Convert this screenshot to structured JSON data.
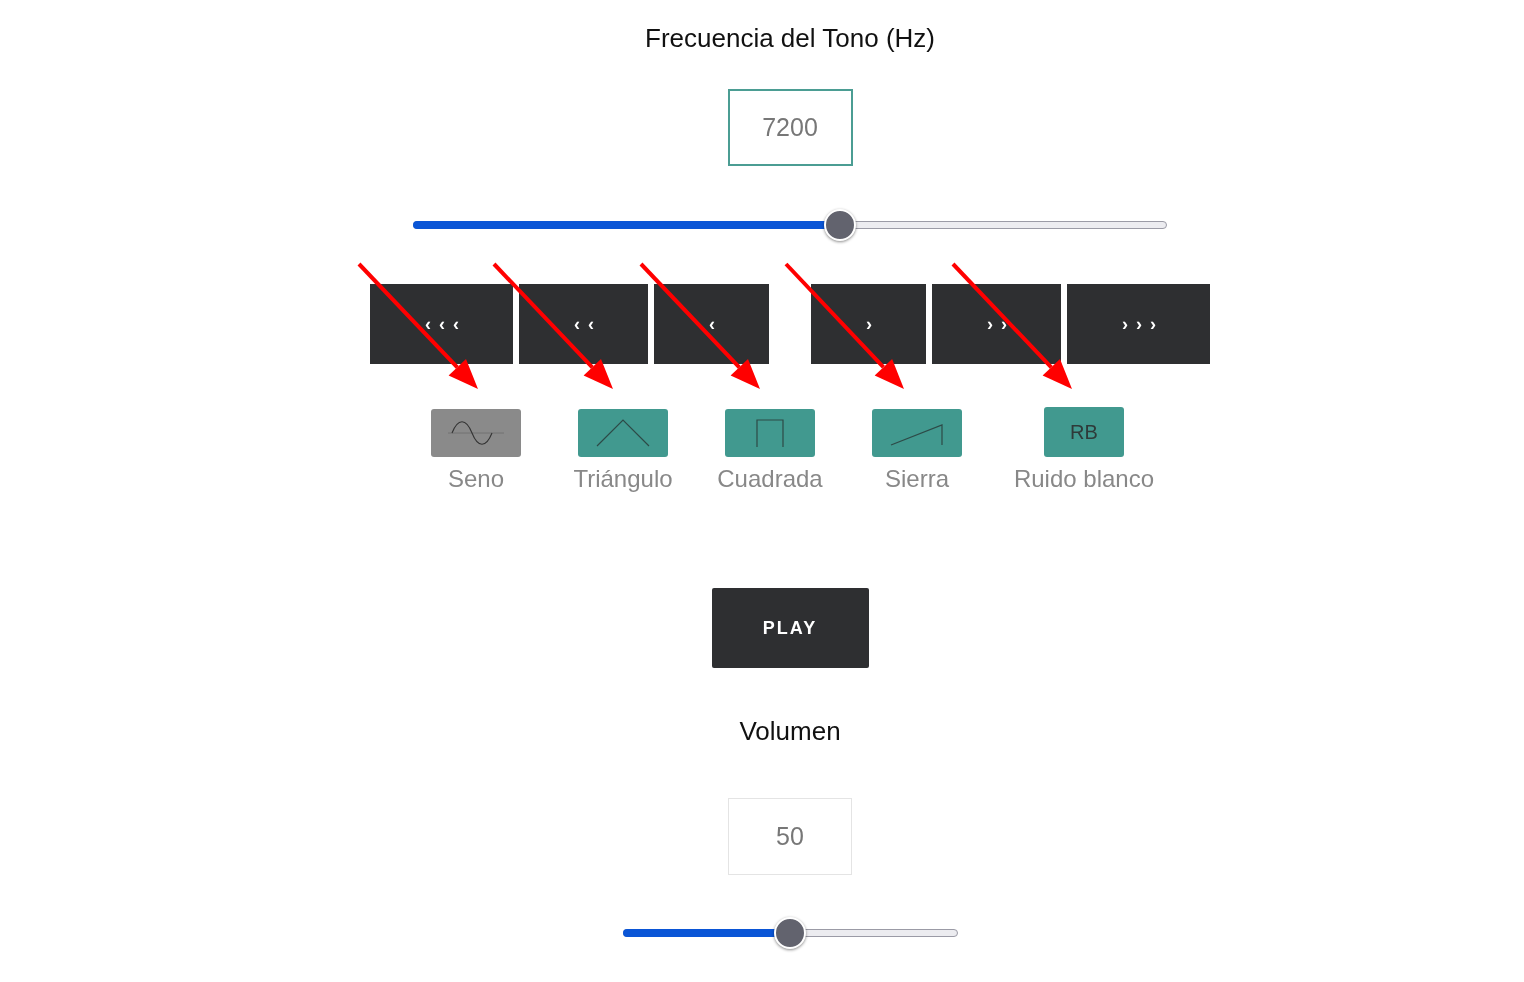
{
  "frequency": {
    "label": "Frecuencia del Tono (Hz)",
    "value": "7200",
    "level": 0.566
  },
  "step_buttons": {
    "down": [
      "‹‹‹",
      "‹‹",
      "‹"
    ],
    "up": [
      "›",
      "››",
      "›››"
    ]
  },
  "annotations": [
    {
      "kind": "arrow"
    },
    {
      "kind": "arrow"
    },
    {
      "kind": "arrow"
    },
    {
      "kind": "arrow"
    },
    {
      "kind": "arrow"
    }
  ],
  "waveforms": [
    {
      "kind": "sine",
      "label": "Seno",
      "selected": true
    },
    {
      "kind": "triangle",
      "label": "Triángulo",
      "selected": false
    },
    {
      "kind": "square",
      "label": "Cuadrada",
      "selected": false
    },
    {
      "kind": "sawtooth",
      "label": "Sierra",
      "selected": false
    },
    {
      "kind": "text",
      "text": "RB",
      "label": "Ruido blanco",
      "selected": false
    }
  ],
  "play_button": "PLAY",
  "volume": {
    "label": "Volumen",
    "value": "50",
    "level": 0.5
  }
}
